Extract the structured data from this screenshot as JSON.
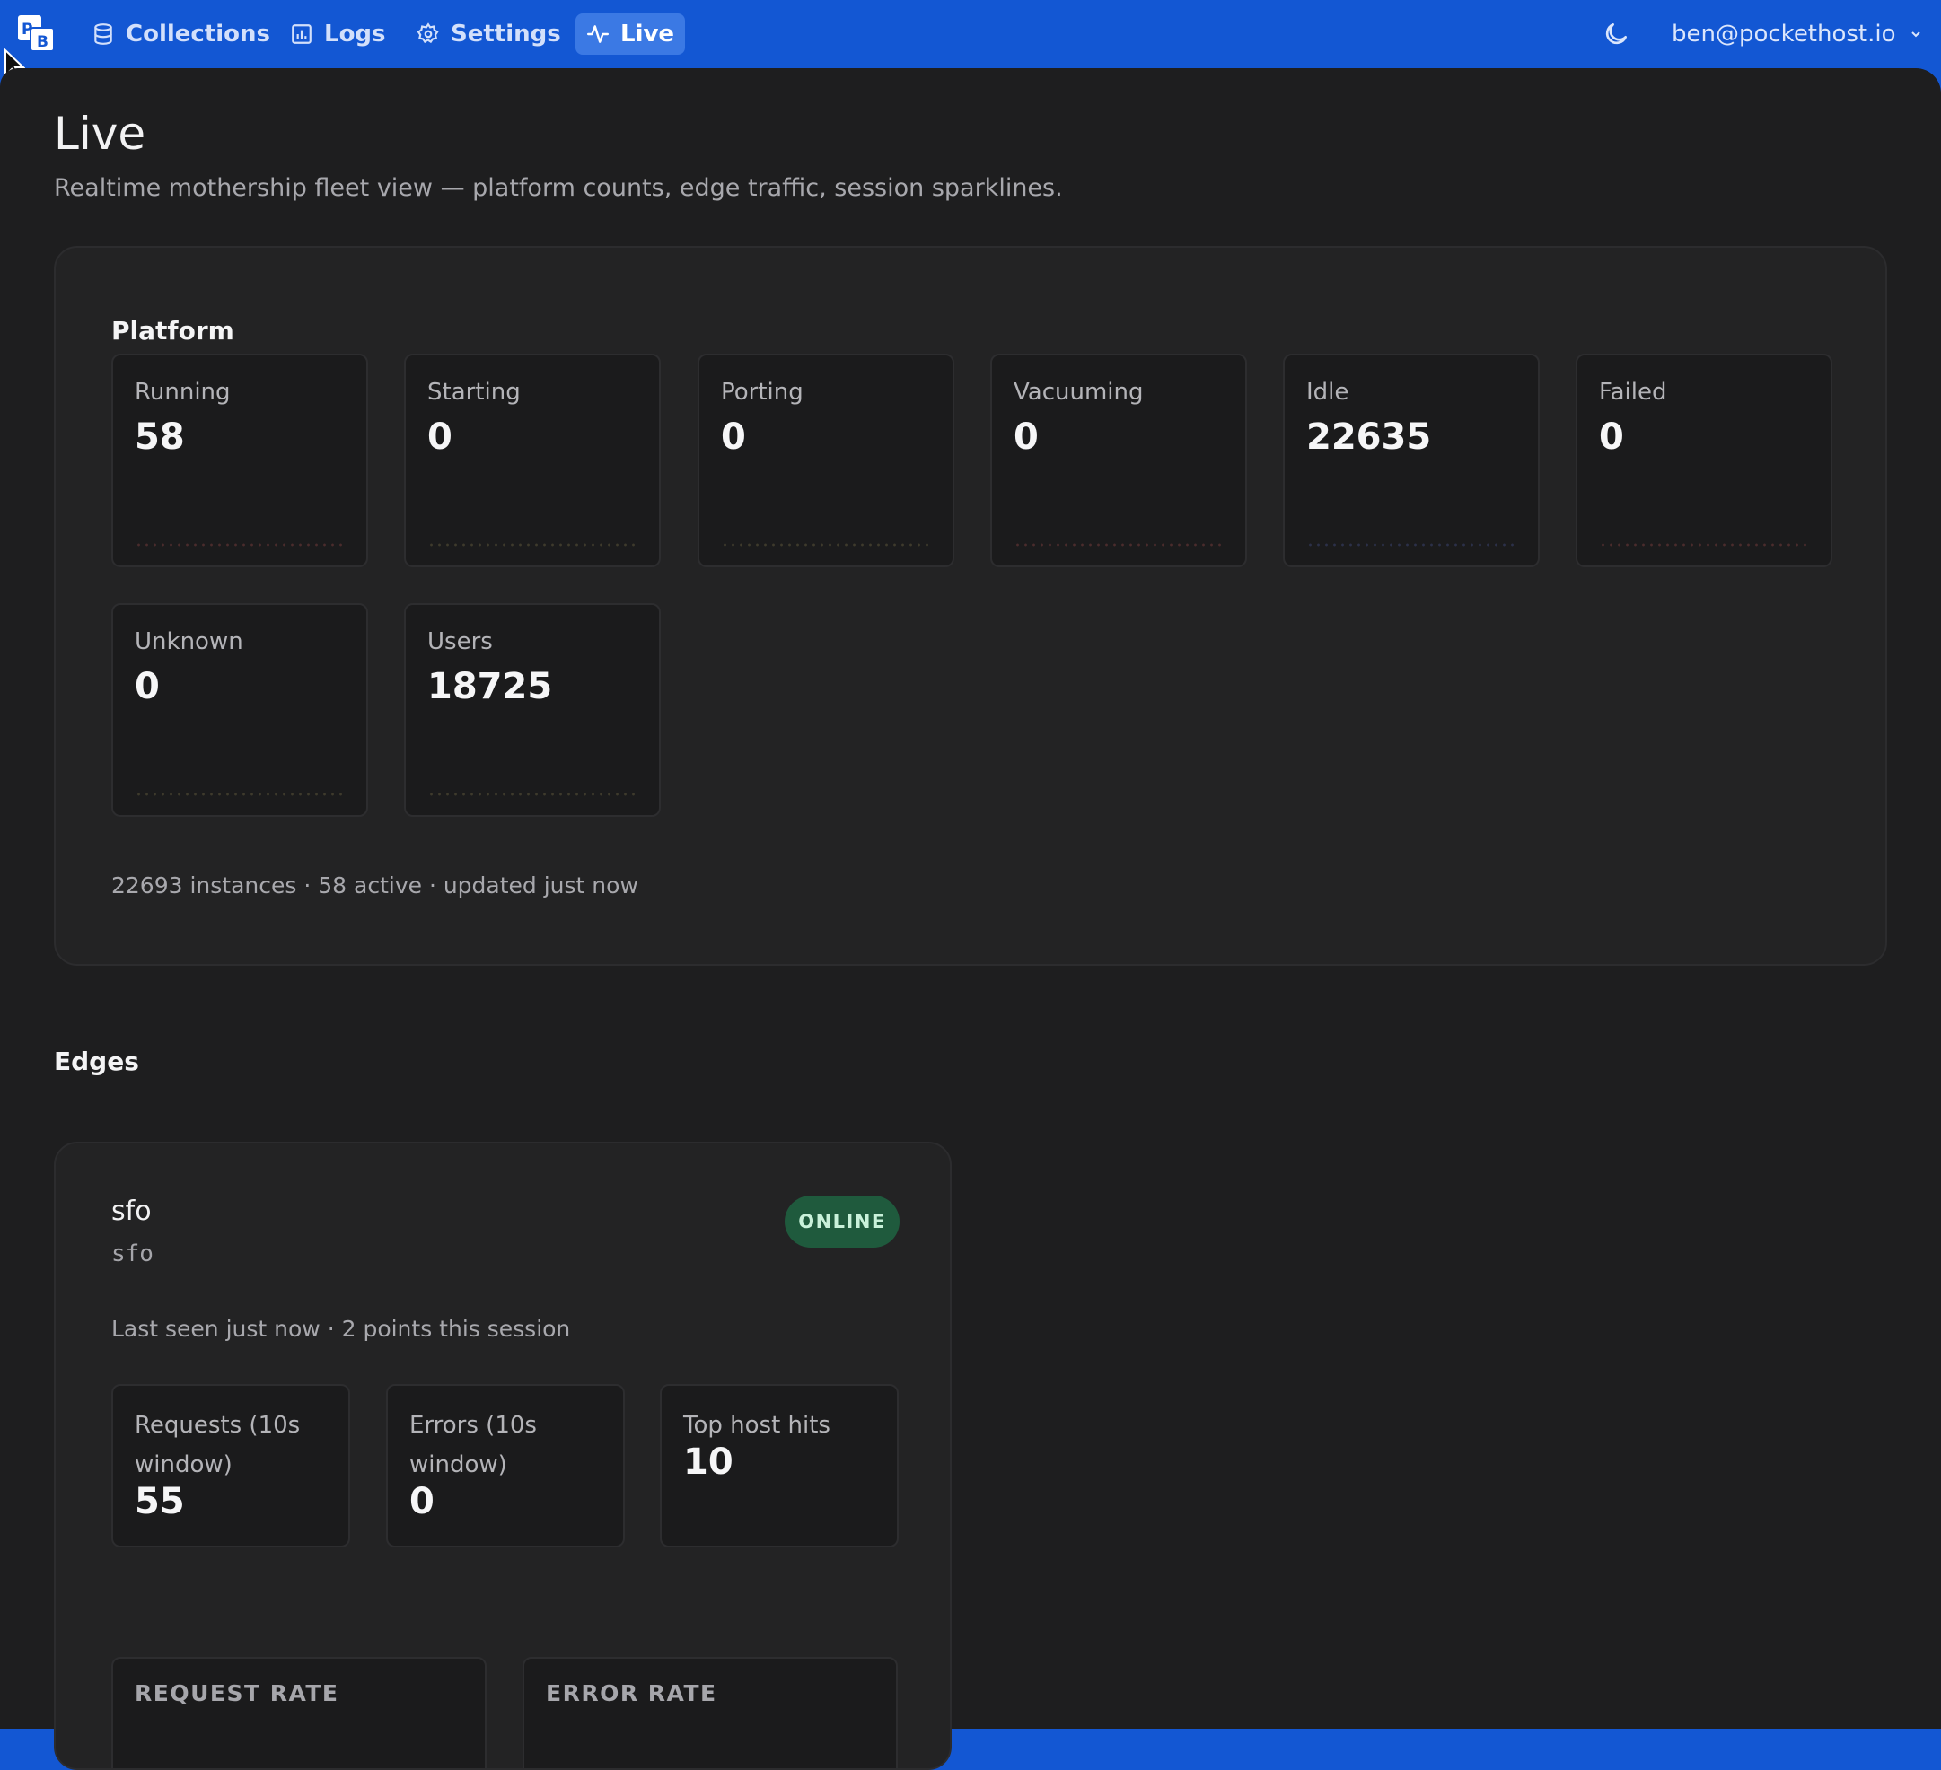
{
  "nav": {
    "logo_letters": [
      "P",
      "B"
    ],
    "items": [
      {
        "label": "Collections",
        "icon": "database-icon"
      },
      {
        "label": "Logs",
        "icon": "chart-icon"
      },
      {
        "label": "Settings",
        "icon": "gear-icon"
      },
      {
        "label": "Live",
        "icon": "pulse-icon",
        "active": true
      }
    ],
    "theme_icon": "moon-icon",
    "user_email": "ben@pockethost.io"
  },
  "page": {
    "title": "Live",
    "subtitle": "Realtime mothership fleet view — platform counts, edge traffic, session sparklines."
  },
  "platform": {
    "heading": "Platform",
    "stats": [
      {
        "label": "Running",
        "value": "58",
        "spark_color": "#4a2c2c"
      },
      {
        "label": "Starting",
        "value": "0",
        "spark_color": "#3e3a2c"
      },
      {
        "label": "Porting",
        "value": "0",
        "spark_color": "#3e3a2c"
      },
      {
        "label": "Vacuuming",
        "value": "0",
        "spark_color": "#4a2c2c"
      },
      {
        "label": "Idle",
        "value": "22635",
        "spark_color": "#2c3049"
      },
      {
        "label": "Failed",
        "value": "0",
        "spark_color": "#4a2c2c"
      },
      {
        "label": "Unknown",
        "value": "0",
        "spark_color": "#3e3a2c"
      },
      {
        "label": "Users",
        "value": "18725",
        "spark_color": "#3e3a2c"
      }
    ],
    "footer": "22693 instances · 58 active · updated just now"
  },
  "edges": {
    "heading": "Edges",
    "items": [
      {
        "name": "sfo",
        "code": "sfo",
        "status": "ONLINE",
        "meta": "Last seen just now · 2 points this session",
        "metrics": [
          {
            "label": "Requests (10s window)",
            "value": "55"
          },
          {
            "label": "Errors (10s window)",
            "value": "0"
          },
          {
            "label": "Top host hits",
            "value": "10"
          }
        ],
        "charts": [
          {
            "label": "REQUEST RATE"
          },
          {
            "label": "ERROR RATE"
          }
        ]
      }
    ]
  },
  "colors": {
    "brand_blue": "#1357d3",
    "active_nav": "#3b79e4",
    "background": "#1e1e1f",
    "online_badge": "#1f5a3d"
  }
}
